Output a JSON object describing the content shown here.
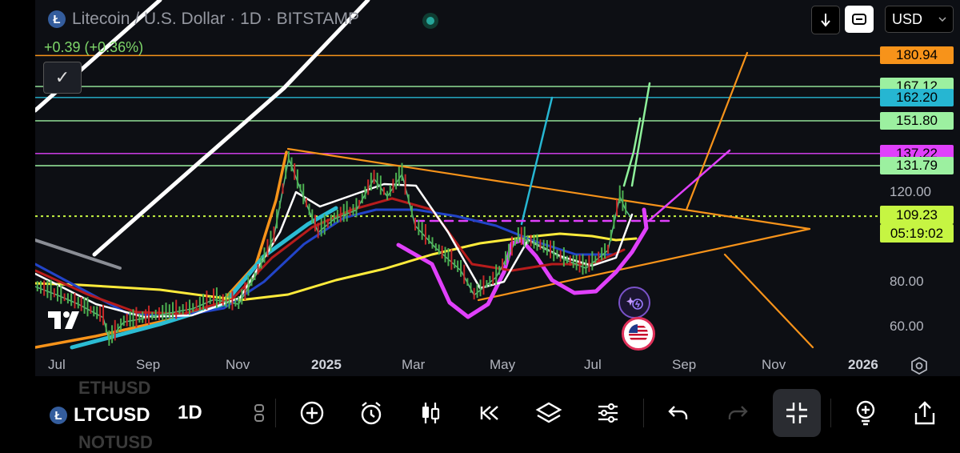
{
  "header": {
    "logo_letter": "Ł",
    "title": "Litecoin / U.S. Dollar · 1D · BITSTAMP",
    "change": "+0.39 (+0.36%)",
    "currency": "USD",
    "collapse_glyph": "✓"
  },
  "chart_data": {
    "type": "candlestick",
    "symbol": "LTCUSD",
    "interval": "1D",
    "exchange": "BITSTAMP",
    "last_price": 109.23,
    "countdown": "05:19:02",
    "y_ticks": [
      {
        "label": "120.00",
        "value": 120
      },
      {
        "label": "80.00",
        "value": 80
      },
      {
        "label": "60.00",
        "value": 60
      }
    ],
    "x_ticks": [
      "Jul",
      "Sep",
      "Nov",
      "2025",
      "Mar",
      "May",
      "Jul",
      "Sep",
      "Nov",
      "2026"
    ],
    "horizontal_levels": [
      {
        "label": "180.94",
        "value": 180.94,
        "color": "#f7931a"
      },
      {
        "label": "167.12",
        "value": 167.12,
        "color": "#9cf0a0"
      },
      {
        "label": "162.20",
        "value": 162.2,
        "color": "#26b6d2"
      },
      {
        "label": "151.80",
        "value": 151.8,
        "color": "#9cf0a0"
      },
      {
        "label": "137.22",
        "value": 137.22,
        "color": "#e040fb"
      },
      {
        "label": "131.79",
        "value": 131.79,
        "color": "#9cf0a0"
      }
    ],
    "current_price": {
      "label": "109.23",
      "value": 109.23,
      "color": "#c6f542"
    },
    "price_series": [
      {
        "date": "2024-06-15",
        "value": 78
      },
      {
        "date": "2024-07-01",
        "value": 74
      },
      {
        "date": "2024-07-15",
        "value": 70
      },
      {
        "date": "2024-08-01",
        "value": 64
      },
      {
        "date": "2024-08-05",
        "value": 54
      },
      {
        "date": "2024-08-15",
        "value": 62
      },
      {
        "date": "2024-09-01",
        "value": 64
      },
      {
        "date": "2024-09-15",
        "value": 66
      },
      {
        "date": "2024-10-01",
        "value": 68
      },
      {
        "date": "2024-10-15",
        "value": 72
      },
      {
        "date": "2024-11-01",
        "value": 70
      },
      {
        "date": "2024-11-12",
        "value": 82
      },
      {
        "date": "2024-11-25",
        "value": 100
      },
      {
        "date": "2024-12-05",
        "value": 135
      },
      {
        "date": "2024-12-15",
        "value": 118
      },
      {
        "date": "2024-12-25",
        "value": 102
      },
      {
        "date": "2025-01-05",
        "value": 108
      },
      {
        "date": "2025-01-20",
        "value": 112
      },
      {
        "date": "2025-02-01",
        "value": 126
      },
      {
        "date": "2025-02-10",
        "value": 118
      },
      {
        "date": "2025-02-20",
        "value": 128
      },
      {
        "date": "2025-03-01",
        "value": 105
      },
      {
        "date": "2025-03-15",
        "value": 95
      },
      {
        "date": "2025-04-01",
        "value": 85
      },
      {
        "date": "2025-04-10",
        "value": 74
      },
      {
        "date": "2025-04-25",
        "value": 82
      },
      {
        "date": "2025-05-10",
        "value": 100
      },
      {
        "date": "2025-05-25",
        "value": 96
      },
      {
        "date": "2025-06-10",
        "value": 90
      },
      {
        "date": "2025-06-25",
        "value": 86
      },
      {
        "date": "2025-07-10",
        "value": 94
      },
      {
        "date": "2025-07-18",
        "value": 118
      },
      {
        "date": "2025-07-22",
        "value": 112
      },
      {
        "date": "2025-07-25",
        "value": 109.23
      }
    ]
  },
  "toolbar": {
    "ticker": "LTCUSD",
    "interval": "1D",
    "ghost_top": "ETHUSD",
    "ghost_bottom": "NOTUSD"
  },
  "colors": {
    "orange": "#f7931a",
    "green": "#9cf0a0",
    "cyan": "#26b6d2",
    "magenta": "#e040fb",
    "yellow": "#ffeb3b",
    "white": "#ffffff",
    "blue": "#2962ff",
    "red": "#b71c1c",
    "lime": "#c6f542"
  }
}
